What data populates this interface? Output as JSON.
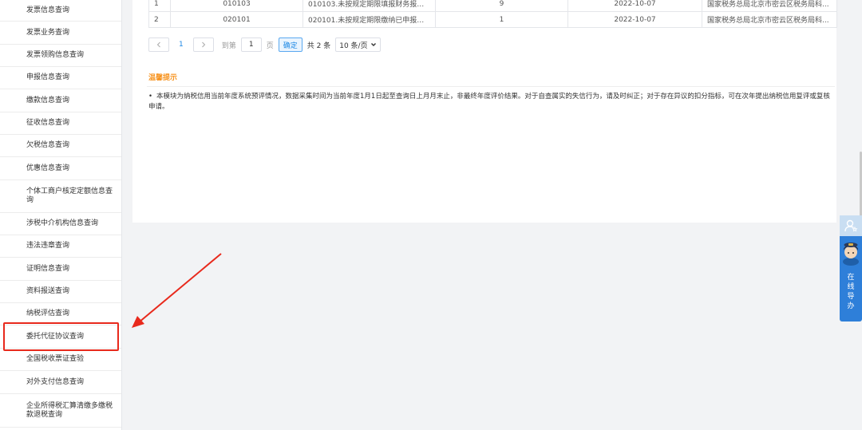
{
  "sidebar": {
    "items": [
      {
        "label": "发票信息查询"
      },
      {
        "label": "发票业务查询"
      },
      {
        "label": "发票领购信息查询"
      },
      {
        "label": "申报信息查询"
      },
      {
        "label": "缴款信息查询"
      },
      {
        "label": "征收信息查询"
      },
      {
        "label": "欠税信息查询"
      },
      {
        "label": "优惠信息查询"
      },
      {
        "label": "个体工商户核定定额信息查询"
      },
      {
        "label": "涉税中介机构信息查询"
      },
      {
        "label": "违法违章查询"
      },
      {
        "label": "证明信息查询"
      },
      {
        "label": "资料报送查询"
      },
      {
        "label": "纳税评估查询"
      },
      {
        "label": "委托代征协议查询"
      },
      {
        "label": "全国税收票证查验"
      },
      {
        "label": "对外支付信息查询"
      },
      {
        "label": "企业所得税汇算清缴多缴税款退税查询"
      }
    ],
    "highlighted_index": 14
  },
  "table": {
    "rows": [
      [
        "1",
        "010103",
        "010103.未按规定期限填报财务报表...",
        "9",
        "2022-10-07",
        "国家税务总局北京市密云区税务局科..."
      ],
      [
        "2",
        "020101",
        "020101.未按规定期限缴纳已申报或...",
        "1",
        "2022-10-07",
        "国家税务总局北京市密云区税务局科..."
      ]
    ]
  },
  "pagination": {
    "prev_icon": "chevron-left-icon",
    "next_icon": "chevron-right-icon",
    "current_page": "1",
    "goto_label": "到第",
    "goto_value": "1",
    "page_unit": "页",
    "confirm_label": "确定",
    "total_label": "共 2 条",
    "page_size_label": "10 条/页"
  },
  "tips": {
    "title": "温馨提示",
    "text": "本模块为纳税信用当前年度系统预评情况，数据采集时间为当前年度1月1日起至查询日上月月末止，非最终年度评价结果。对于自查属实的失信行为，请及时纠正；对于存在异议的扣分指标，可在次年提出纳税信用复评或复核申请。"
  },
  "float_widget": {
    "label": "在线导办",
    "icon": "user-star-icon",
    "avatar": "assistant-avatar-icon"
  },
  "colors": {
    "accent": "#1e88e5",
    "tip_title": "#f7931e",
    "annotation_red": "#e8291c",
    "widget_blue": "#2e7fd9"
  }
}
